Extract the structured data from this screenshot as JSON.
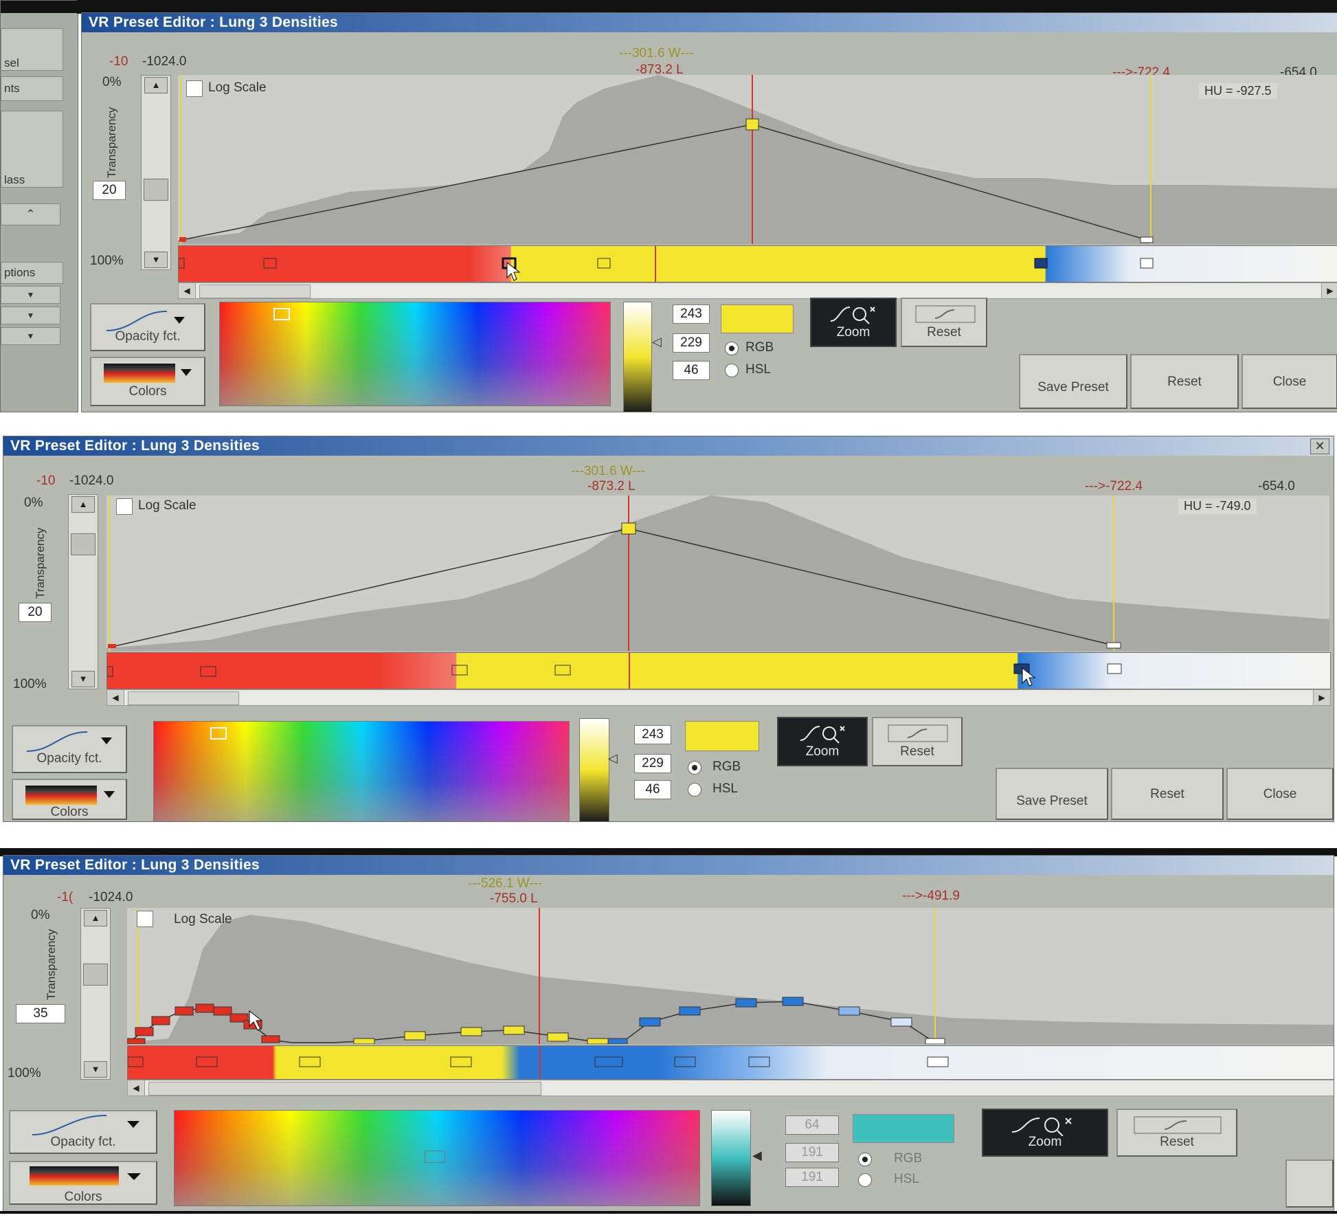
{
  "panels": [
    {
      "title": "VR Preset Editor : Lung 3 Densities",
      "left_value_prefix": "-10",
      "left_value": "-1024.0",
      "window_width": "---301.6 W---",
      "level": "-873.2 L",
      "right_marker": "--->-722.4",
      "right_value": "-654.0",
      "hu_readout": "HU = -927.5",
      "opacity_top": "0%",
      "opacity_bottom": "100%",
      "transparency_label": "Transparency",
      "transparency_value": "20",
      "log_scale": "Log Scale",
      "rgb": [
        "243",
        "229",
        "46"
      ],
      "swatch_color": "#f3e52e",
      "rgb_label": "RGB",
      "hsl_label": "HSL",
      "zoom_label": "Zoom",
      "reset_small_label": "Reset",
      "opacity_fct_label": "Opacity fct.",
      "colors_label": "Colors",
      "save_preset_label": "Save Preset",
      "reset_label": "Reset",
      "close_label": "Close",
      "sidebar": [
        "sel",
        "nts",
        "lass",
        "ptions"
      ]
    },
    {
      "title": "VR Preset Editor : Lung 3 Densities",
      "left_value_prefix": "-10",
      "left_value": "-1024.0",
      "window_width": "---301.6 W---",
      "level": "-873.2 L",
      "right_marker": "--->-722.4",
      "right_value": "-654.0",
      "hu_readout": "HU = -749.0",
      "opacity_top": "0%",
      "opacity_bottom": "100%",
      "transparency_label": "Transparency",
      "transparency_value": "20",
      "log_scale": "Log Scale",
      "rgb": [
        "243",
        "229",
        "46"
      ],
      "swatch_color": "#f3e52e",
      "rgb_label": "RGB",
      "hsl_label": "HSL",
      "zoom_label": "Zoom",
      "reset_small_label": "Reset",
      "opacity_fct_label": "Opacity fct.",
      "colors_label": "Colors",
      "save_preset_label": "Save Preset",
      "reset_label": "Reset",
      "close_label": "Close"
    },
    {
      "title": "VR Preset Editor : Lung 3 Densities",
      "left_value_prefix": "-1(",
      "left_value": "-1024.0",
      "window_width": "---526.1 W---",
      "level": "-755.0 L",
      "right_marker": "--->-491.9",
      "opacity_top": "0%",
      "opacity_bottom": "100%",
      "transparency_label": "Transparency",
      "transparency_value": "35",
      "log_scale": "Log Scale",
      "rgb": [
        "64",
        "191",
        "191"
      ],
      "swatch_color": "#40bfbf",
      "rgb_label": "RGB",
      "hsl_label": "HSL",
      "zoom_label": "Zoom",
      "reset_small_label": "Reset",
      "opacity_fct_label": "Opacity fct.",
      "colors_label": "Colors"
    }
  ],
  "colors": {
    "red": "#f03a2c",
    "yellow": "#f3e52e",
    "blue": "#2a78d6",
    "white": "#f4f4f2",
    "level_line": "#e03020",
    "window_line": "#e6d83a",
    "titlebar": "#1d4d97"
  }
}
